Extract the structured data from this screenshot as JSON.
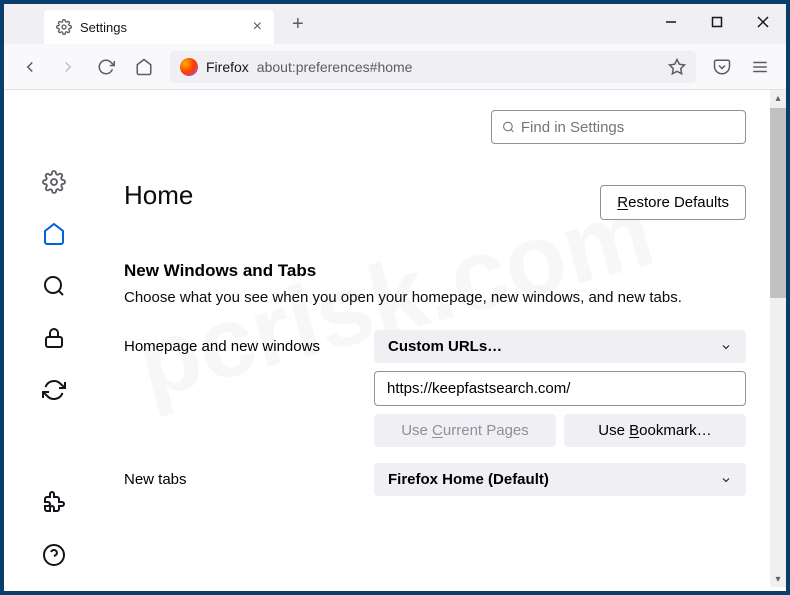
{
  "tab": {
    "title": "Settings"
  },
  "urlbar": {
    "label": "Firefox",
    "url": "about:preferences#home"
  },
  "search": {
    "placeholder": "Find in Settings"
  },
  "page": {
    "title": "Home",
    "restore_button": "Restore Defaults"
  },
  "section": {
    "title": "New Windows and Tabs",
    "desc": "Choose what you see when you open your homepage, new windows, and new tabs."
  },
  "homepage": {
    "label": "Homepage and new windows",
    "mode": "Custom URLs…",
    "url": "https://keepfastsearch.com/",
    "use_current": "Use Current Pages",
    "use_bookmark": "Use Bookmark…"
  },
  "newtabs": {
    "label": "New tabs",
    "mode": "Firefox Home (Default)"
  }
}
